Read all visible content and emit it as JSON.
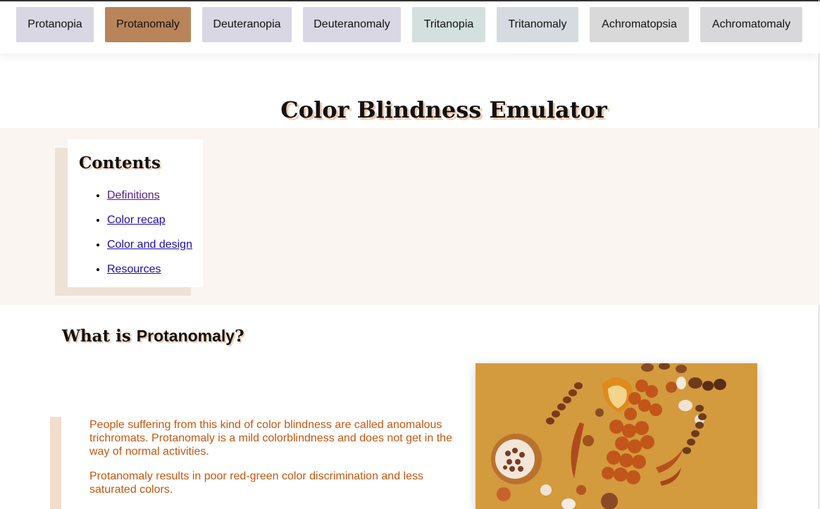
{
  "nav": {
    "tabs": [
      {
        "label": "Protanopia",
        "color": "#d8d7e3"
      },
      {
        "label": "Protanomaly",
        "color": "#b9845a",
        "active": true
      },
      {
        "label": "Deuteranopia",
        "color": "#d8d7e3"
      },
      {
        "label": "Deuteranomaly",
        "color": "#d8d7e3"
      },
      {
        "label": "Tritanopia",
        "color": "#d3e0de"
      },
      {
        "label": "Tritanomaly",
        "color": "#d5dbe1"
      },
      {
        "label": "Achromatopsia",
        "color": "#d9d9d9"
      },
      {
        "label": "Achromatomaly",
        "color": "#d8d8da"
      }
    ]
  },
  "page": {
    "title": "Color Blindness Emulator"
  },
  "toc": {
    "heading": "Contents",
    "items": [
      {
        "label": "Definitions"
      },
      {
        "label": "Color recap"
      },
      {
        "label": "Color and design"
      },
      {
        "label": "Resources"
      }
    ]
  },
  "section": {
    "prefix": "What is ",
    "term": "Protanomaly",
    "suffix": "?",
    "paragraphs": [
      "People suffering from this kind of color blindness are called anomalous trichromats. Protanomaly is a mild colorblindness and does not get in the way of normal activities.",
      "Protanomaly results in poor red-green color discrimination and less saturated colors."
    ]
  },
  "colors": {
    "accent": "#b9845a",
    "text_accent": "#c5560e",
    "band_bg": "#faf5f0",
    "photo_bg": "#d39a3e"
  }
}
